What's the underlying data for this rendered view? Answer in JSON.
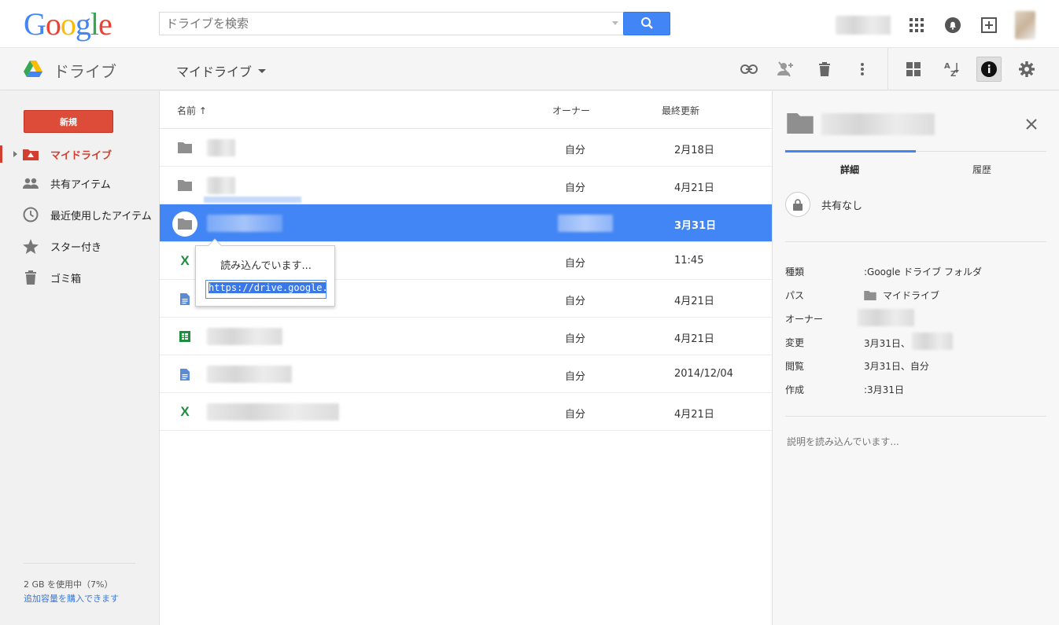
{
  "header": {
    "logo": "Google",
    "search_placeholder": "ドライブを検索"
  },
  "toolbar": {
    "app_name": "ドライブ",
    "location_menu": "マイドライブ"
  },
  "sidebar": {
    "new_button": "新規",
    "items": [
      {
        "label": "マイドライブ",
        "icon": "my-drive-icon",
        "active": true
      },
      {
        "label": "共有アイテム",
        "icon": "people-icon"
      },
      {
        "label": "最近使用したアイテム",
        "icon": "clock-icon"
      },
      {
        "label": "スター付き",
        "icon": "star-icon"
      },
      {
        "label": "ゴミ箱",
        "icon": "trash-icon"
      }
    ],
    "storage_text": "2 GB を使用中（7%）",
    "storage_link": "追加容量を購入できます"
  },
  "list": {
    "columns": {
      "name": "名前 ↑",
      "owner": "オーナー",
      "modified": "最終更新"
    },
    "rows": [
      {
        "type": "folder",
        "owner": "自分",
        "modified": "2月18日"
      },
      {
        "type": "folder",
        "owner": "自分",
        "modified": "4月21日"
      },
      {
        "type": "folder",
        "owner": "",
        "modified": "3月31日",
        "selected": true
      },
      {
        "type": "excel",
        "owner": "自分",
        "modified": "11:45"
      },
      {
        "type": "doc",
        "owner": "自分",
        "modified": "4月21日"
      },
      {
        "type": "sheet",
        "owner": "自分",
        "modified": "4月21日"
      },
      {
        "type": "doc",
        "owner": "自分",
        "modified": "2014/12/04"
      },
      {
        "type": "excel",
        "owner": "自分",
        "modified": "4月21日"
      }
    ]
  },
  "popup": {
    "loading": "読み込んでいます...",
    "url": "https://drive.google.c"
  },
  "details": {
    "tabs": [
      "詳細",
      "履歴"
    ],
    "sharing": "共有なし",
    "props": [
      {
        "label": "種類",
        "value": ":Google ドライブ フォルダ"
      },
      {
        "label": "パス",
        "value": "マイドライブ"
      },
      {
        "label": "オーナー",
        "value": ""
      },
      {
        "label": "変更",
        "value": "3月31日、"
      },
      {
        "label": "閲覧",
        "value": "3月31日、自分"
      },
      {
        "label": "作成",
        "value": ":3月31日"
      }
    ],
    "description_loading": "説明を読み込んでいます..."
  },
  "colors": {
    "accent": "#4285f4",
    "new_button": "#dd4b39",
    "active_nav": "#d23f31"
  }
}
